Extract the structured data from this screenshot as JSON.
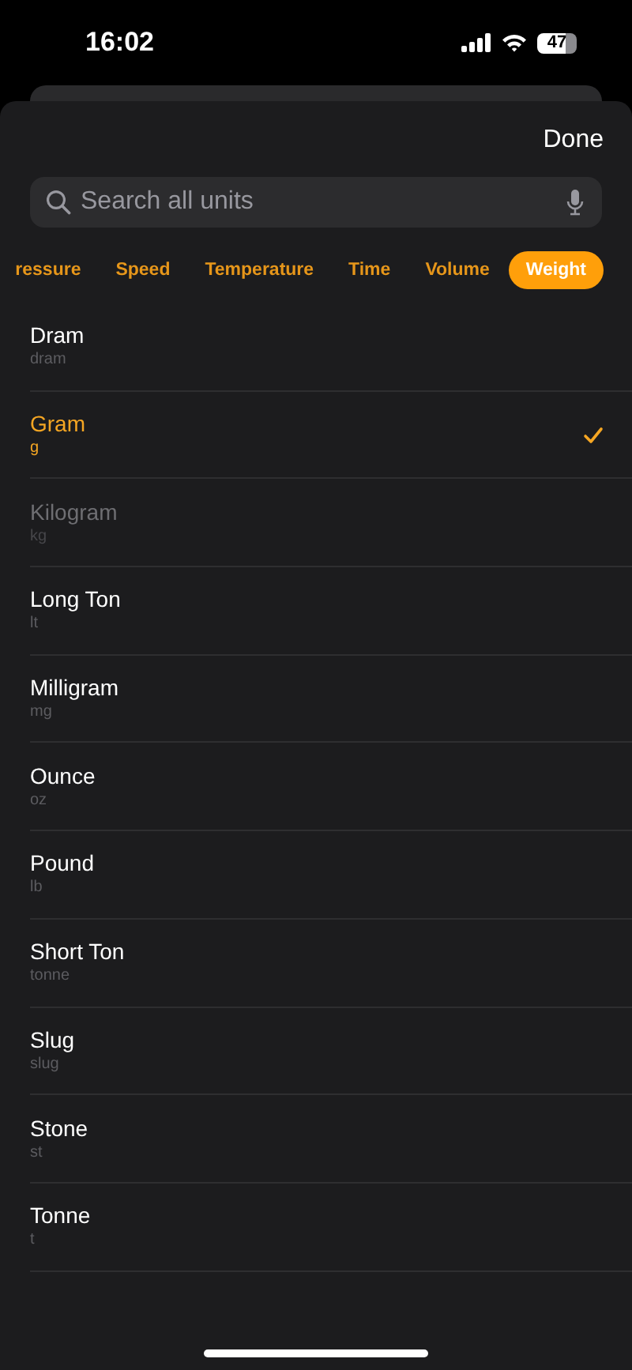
{
  "status_bar": {
    "time": "16:02",
    "battery": "47"
  },
  "done_button": "Done",
  "search": {
    "placeholder": "Search all units"
  },
  "categories": [
    {
      "label": "ressure",
      "selected": false
    },
    {
      "label": "Speed",
      "selected": false
    },
    {
      "label": "Temperature",
      "selected": false
    },
    {
      "label": "Time",
      "selected": false
    },
    {
      "label": "Volume",
      "selected": false
    },
    {
      "label": "Weight",
      "selected": true
    }
  ],
  "units": [
    {
      "name": "Dram",
      "symbol": "dram",
      "selected": false,
      "disabled": false
    },
    {
      "name": "Gram",
      "symbol": "g",
      "selected": true,
      "disabled": false
    },
    {
      "name": "Kilogram",
      "symbol": "kg",
      "selected": false,
      "disabled": true
    },
    {
      "name": "Long Ton",
      "symbol": "lt",
      "selected": false,
      "disabled": false
    },
    {
      "name": "Milligram",
      "symbol": "mg",
      "selected": false,
      "disabled": false
    },
    {
      "name": "Ounce",
      "symbol": "oz",
      "selected": false,
      "disabled": false
    },
    {
      "name": "Pound",
      "symbol": "lb",
      "selected": false,
      "disabled": false
    },
    {
      "name": "Short Ton",
      "symbol": "tonne",
      "selected": false,
      "disabled": false
    },
    {
      "name": "Slug",
      "symbol": "slug",
      "selected": false,
      "disabled": false
    },
    {
      "name": "Stone",
      "symbol": "st",
      "selected": false,
      "disabled": false
    },
    {
      "name": "Tonne",
      "symbol": "t",
      "selected": false,
      "disabled": false
    }
  ]
}
